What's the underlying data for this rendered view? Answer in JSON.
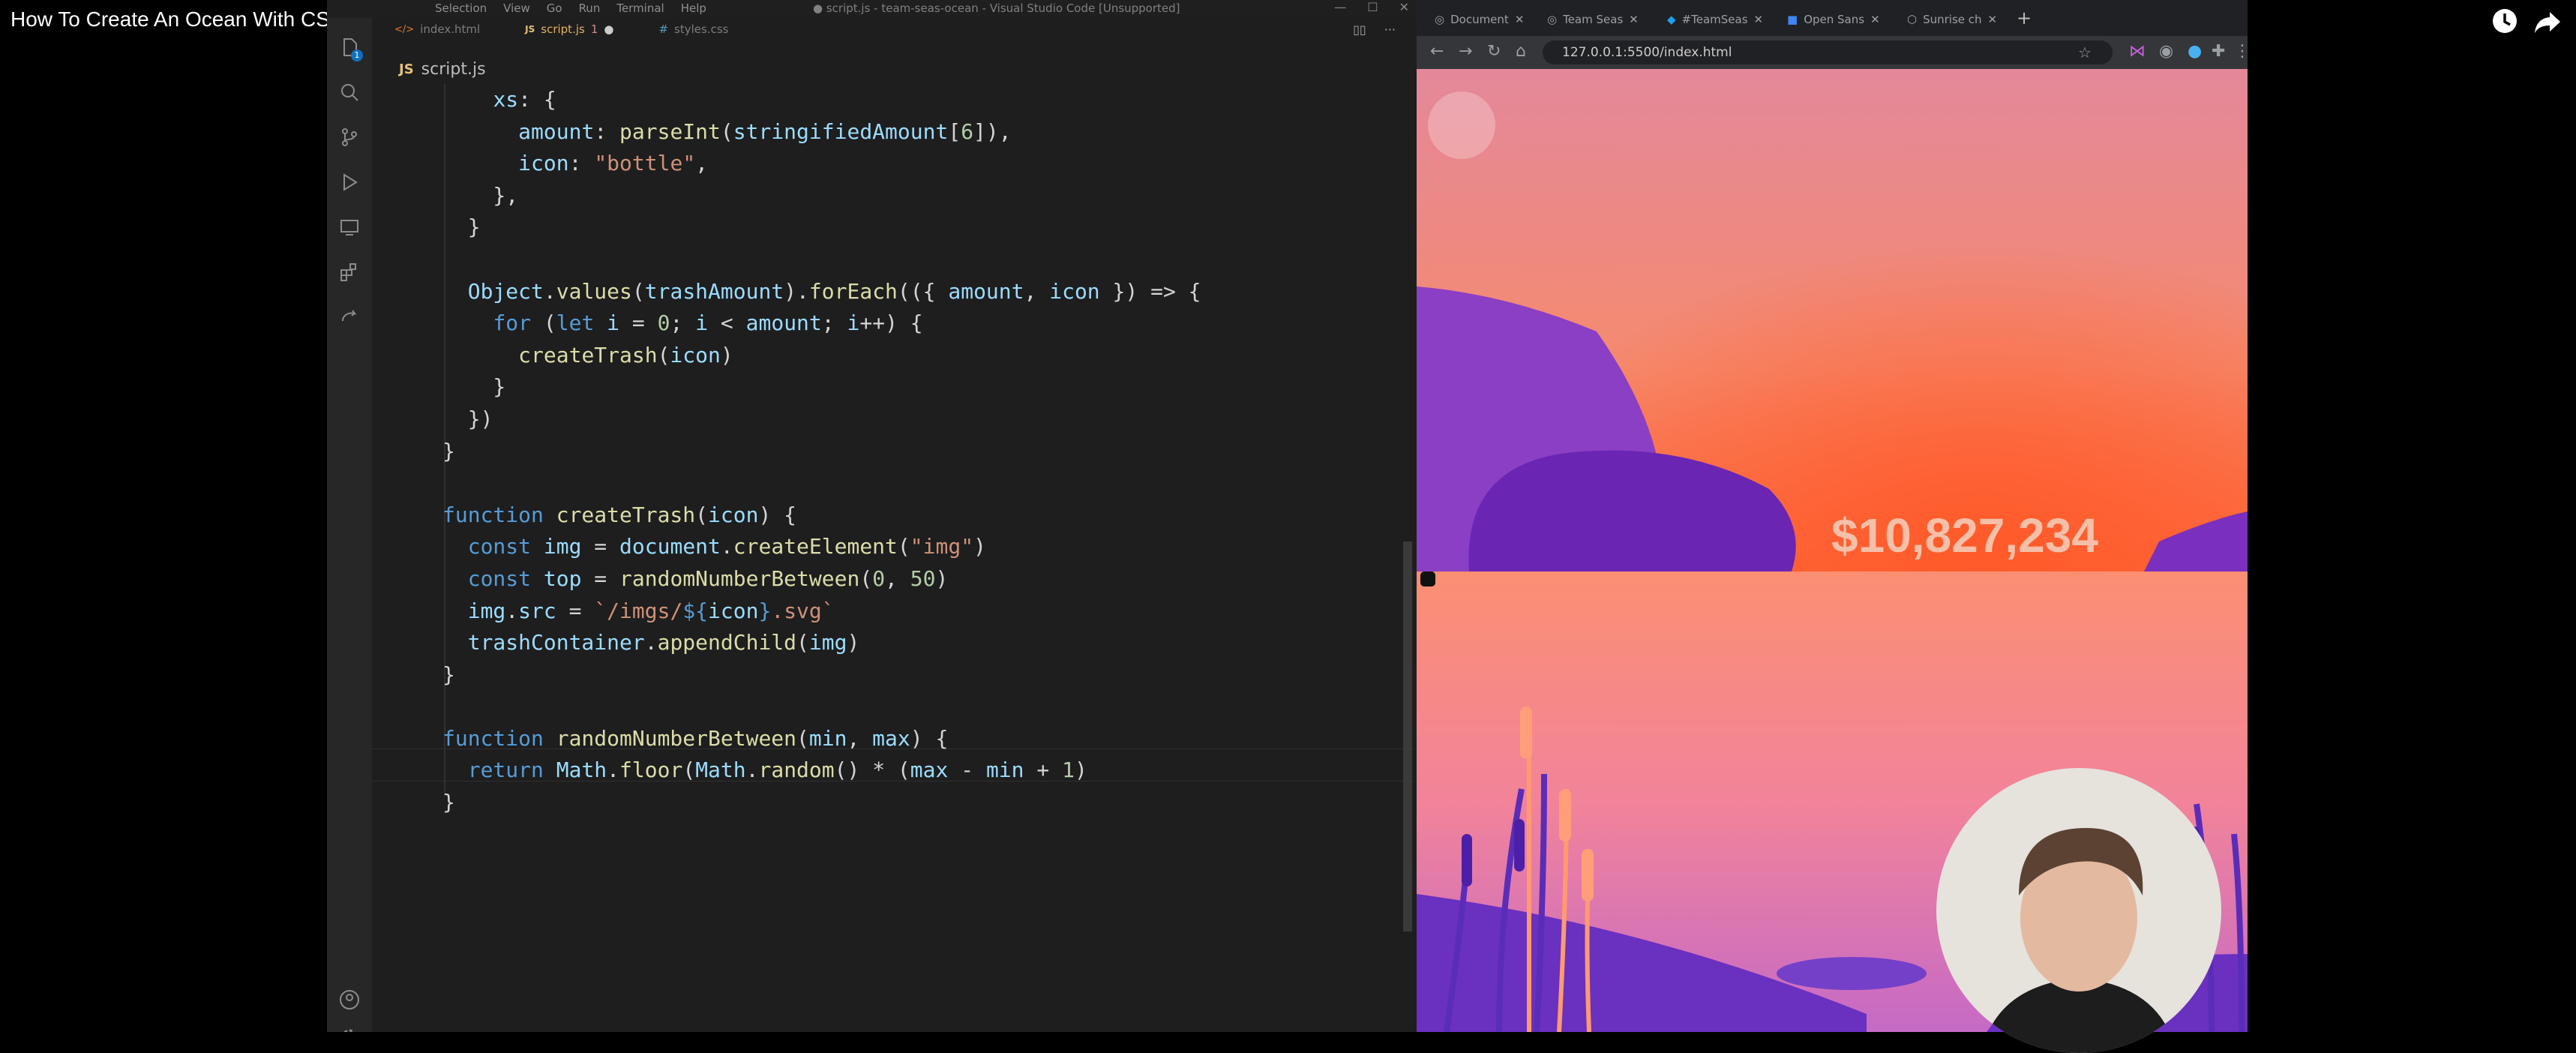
{
  "video": {
    "title": "How To Create An Ocean With CSS/JavaScript",
    "watch_later_icon": "clock-icon",
    "share_icon": "share-icon"
  },
  "vscode": {
    "menu": [
      "Selection",
      "View",
      "Go",
      "Run",
      "Terminal",
      "Help"
    ],
    "window_title": "● script.js - team-seas-ocean - Visual Studio Code [Unsupported]",
    "tabs": [
      {
        "label": "index.html",
        "badge": "",
        "modified": ""
      },
      {
        "label": "script.js",
        "badge": "1",
        "modified": "●"
      },
      {
        "label": "styles.css",
        "badge": "",
        "modified": ""
      }
    ],
    "breadcrumb": {
      "lang": "JS",
      "file": "script.js"
    },
    "activity_badge": "1",
    "code_lines": [
      "    xs: {",
      "      amount: parseInt(stringifiedAmount[6]),",
      "      icon: \"bottle\",",
      "    },",
      "  }",
      "",
      "  Object.values(trashAmount).forEach(({ amount, icon }) => {",
      "    for (let i = 0; i < amount; i++) {",
      "      createTrash(icon)",
      "    }",
      "  })",
      "}",
      "",
      "function createTrash(icon) {",
      "  const img = document.createElement(\"img\")",
      "  const top = randomNumberBetween(0, 50)",
      "  img.src = `/imgs/${icon}.svg`",
      "  trashContainer.appendChild(img)",
      "}",
      "",
      "function randomNumberBetween(min, max) {",
      "  return Math.floor(Math.random() * (max - min + 1)",
      "}"
    ]
  },
  "browser": {
    "tabs": [
      "Document",
      "Team Seas",
      "#TeamSeas",
      "Open Sans",
      "Sunrise ch"
    ],
    "url": "127.0.0.1:5500/index.html",
    "counter": "$10,827,234"
  },
  "colors": {
    "sky_top": "#e8898f",
    "sky_mid": "#fb7a5e",
    "island_purple": "#6a2ab6",
    "water": "#f4917a",
    "ground_purple": "#5a2bb0"
  }
}
